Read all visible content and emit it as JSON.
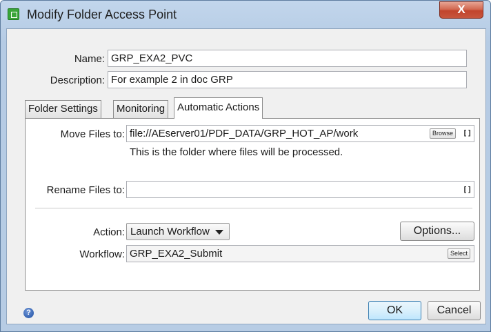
{
  "window": {
    "title": "Modify Folder Access Point",
    "close_label": "X"
  },
  "form": {
    "name_label": "Name:",
    "name_value": "GRP_EXA2_PVC",
    "description_label": "Description:",
    "description_value": "For example 2 in doc GRP"
  },
  "tabs": [
    {
      "label": "Folder Settings",
      "active": false
    },
    {
      "label": "Monitoring",
      "active": false
    },
    {
      "label": "Automatic Actions",
      "active": true
    }
  ],
  "panel": {
    "move_label": "Move Files to:",
    "move_value": "file://AEserver01/PDF_DATA/GRP_HOT_AP/work",
    "browse_label": "Browse",
    "brackets": "[]",
    "move_hint": "This is the folder where files will be processed.",
    "rename_label": "Rename Files to:",
    "rename_value": "",
    "action_label": "Action:",
    "action_value": "Launch Workflow",
    "options_label": "Options...",
    "workflow_label": "Workflow:",
    "workflow_value": "GRP_EXA2_Submit",
    "select_label": "Select"
  },
  "footer": {
    "help_icon": "question-circle-icon",
    "help_glyph": "?",
    "ok_label": "OK",
    "cancel_label": "Cancel"
  },
  "colors": {
    "titlebar": "#b5cbe4",
    "close_button": "#c7553c",
    "app_icon": "#3aa53a",
    "default_button": "#bee6fd"
  }
}
